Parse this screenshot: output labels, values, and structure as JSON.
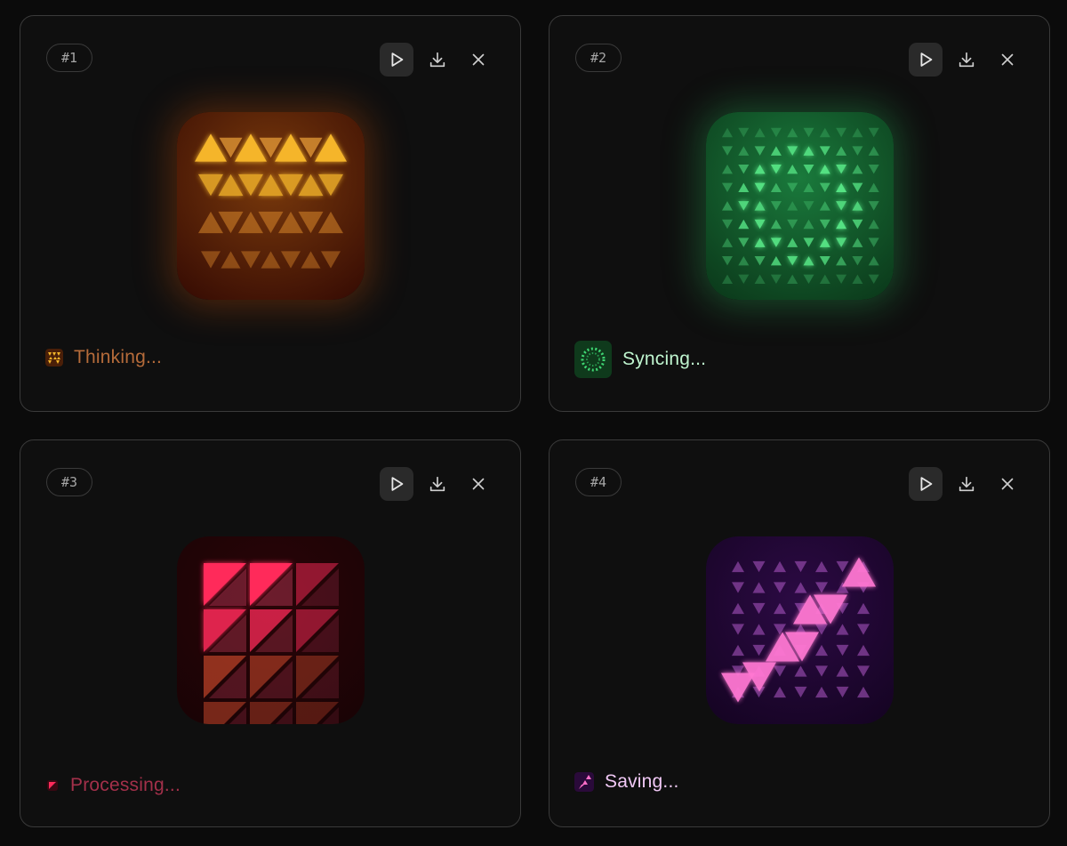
{
  "cards": [
    {
      "badge": "#1",
      "status": "Thinking...",
      "status_color": "#b56b3a",
      "theme": "amber",
      "actions": {
        "play": "play-icon",
        "download": "download-icon",
        "close": "close-icon"
      }
    },
    {
      "badge": "#2",
      "status": "Syncing...",
      "status_color": "#bff5cf",
      "theme": "green",
      "actions": {
        "play": "play-icon",
        "download": "download-icon",
        "close": "close-icon"
      }
    },
    {
      "badge": "#3",
      "status": "Processing...",
      "status_color": "#a3304a",
      "theme": "red",
      "actions": {
        "play": "play-icon",
        "download": "download-icon",
        "close": "close-icon"
      }
    },
    {
      "badge": "#4",
      "status": "Saving...",
      "status_color": "#f0c8f5",
      "theme": "violet",
      "actions": {
        "play": "play-icon",
        "download": "download-icon",
        "close": "close-icon"
      }
    }
  ],
  "colors": {
    "background": "#0b0b0b",
    "card": "#0f0f0f",
    "border": "#3a3a3a",
    "amber": "#f5b52a",
    "green": "#3fd874",
    "red": "#ff2a5a",
    "violet": "#ff6ec8"
  }
}
